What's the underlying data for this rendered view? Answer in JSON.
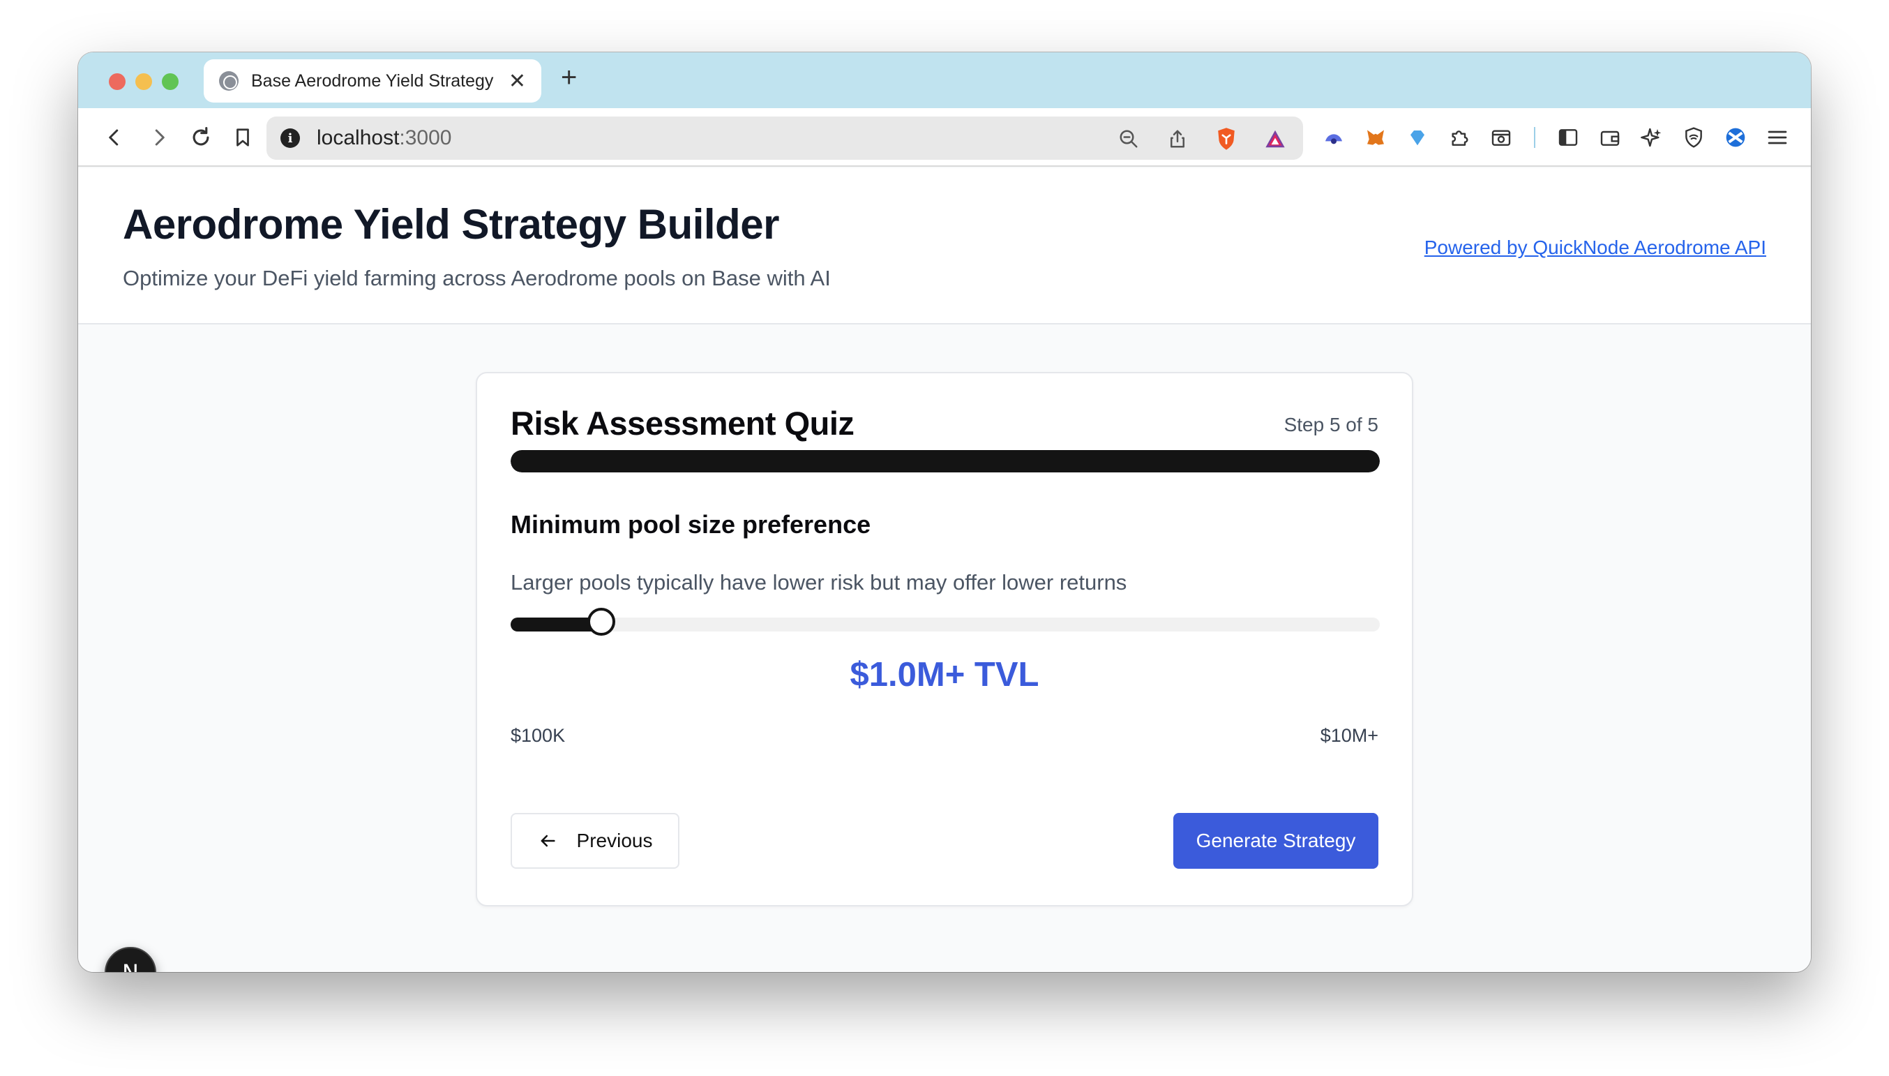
{
  "browser": {
    "tab_title": "Base Aerodrome Yield Strategy Builder",
    "tab_close": "✕",
    "new_tab": "+",
    "url_host": "localhost",
    "url_port": ":3000",
    "icons": [
      "back-icon",
      "forward-icon",
      "reload-icon",
      "bookmark-icon",
      "info-icon",
      "zoom-out-icon",
      "share-icon",
      "brave-shield-icon",
      "brave-rewards-icon",
      "extension-icons",
      "sidebar-icon",
      "wallet-icon",
      "leo-icon",
      "vpn-icon",
      "menu-icon"
    ]
  },
  "header": {
    "title": "Aerodrome Yield Strategy Builder",
    "subtitle": "Optimize your DeFi yield farming across Aerodrome pools on Base with AI",
    "powered_link": "Powered by QuickNode Aerodrome API"
  },
  "quiz": {
    "title": "Risk Assessment Quiz",
    "step_label": "Step 5 of 5",
    "progress": 1.0,
    "question": "Minimum pool size preference",
    "hint": "Larger pools typically have lower risk but may offer lower returns",
    "slider_value": 0.104,
    "value_display": "$1.0M+ TVL",
    "min_label": "$100K",
    "max_label": "$10M+",
    "prev_label": "Previous",
    "generate_label": "Generate Strategy"
  },
  "colors": {
    "accent": "#3b5bdb",
    "tabstrip": "#c0e3ef",
    "progress": "#141414"
  },
  "badge": "N"
}
